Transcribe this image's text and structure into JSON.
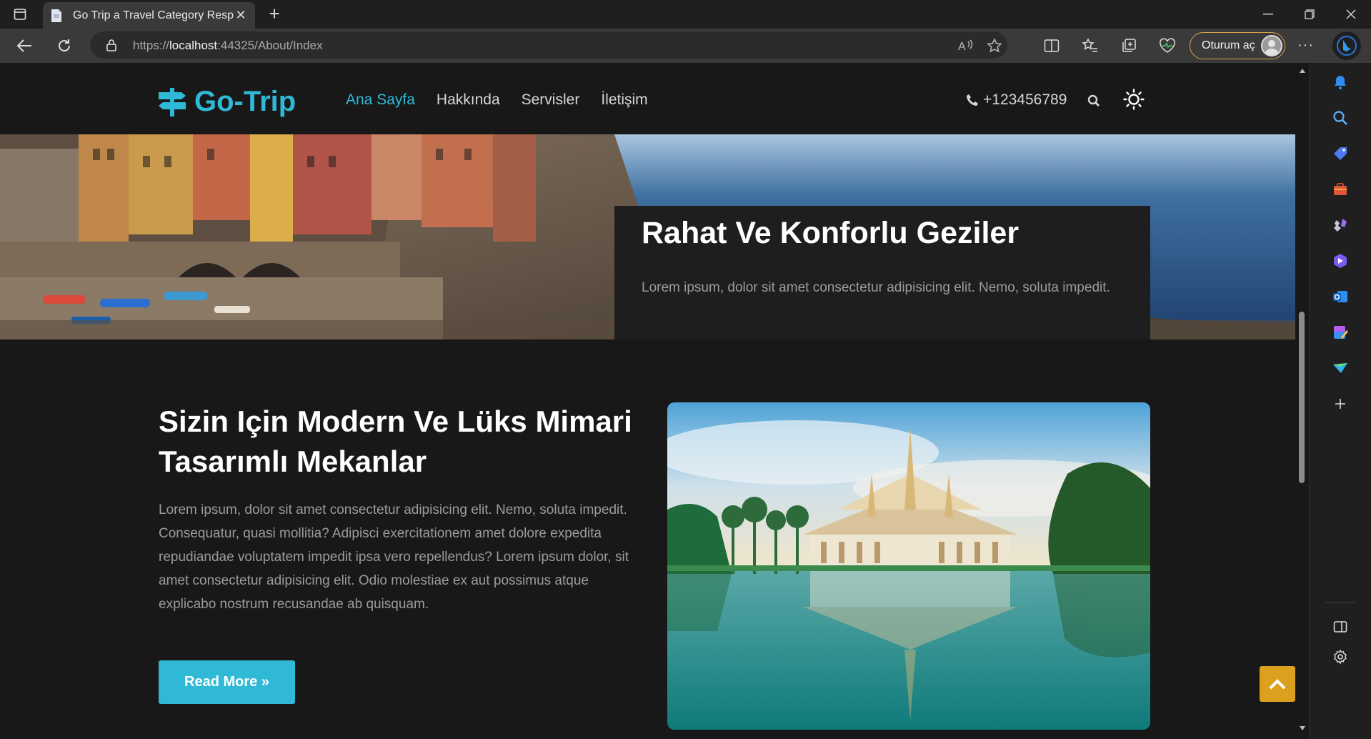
{
  "browser": {
    "tab_title": "Go Trip a Travel Category Respon",
    "url_prefix": "https://",
    "url_host": "localhost",
    "url_rest": ":44325/About/Index",
    "signin_label": "Oturum aç"
  },
  "site": {
    "logo": "Go-Trip",
    "nav": [
      "Ana Sayfa",
      "Hakkında",
      "Servisler",
      "İletişim"
    ],
    "phone": "+123456789"
  },
  "hero": {
    "title": "Rahat Ve Konforlu Geziler",
    "text": "Lorem ipsum, dolor sit amet consectetur adipisicing elit. Nemo, soluta impedit."
  },
  "about": {
    "title": "Sizin Için Modern Ve Lüks Mimari Tasarımlı Mekanlar",
    "text": "Lorem ipsum, dolor sit amet consectetur adipisicing elit. Nemo, soluta impedit. Consequatur, quasi mollitia? Adipisci exercitationem amet dolore expedita repudiandae voluptatem impedit ipsa vero repellendus? Lorem ipsum dolor, sit amet consectetur adipisicing elit. Odio molestiae ex aut possimus atque explicabo nostrum recusandae ab quisquam.",
    "button": "Read More »"
  },
  "colors": {
    "accent": "#2fb9d6",
    "to_top": "#dca01e",
    "background": "#181818",
    "signin_border": "#d9a44a"
  }
}
